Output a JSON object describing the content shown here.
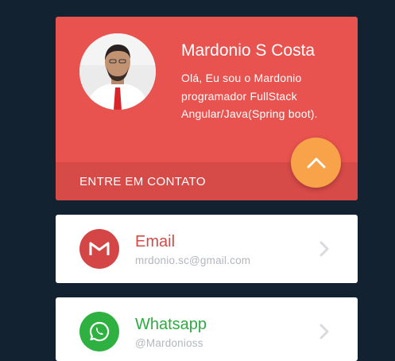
{
  "profile": {
    "name": "Mardonio S Costa",
    "bio": "Olá, Eu sou o Mardonio programador FullStack Angular/Java(Spring boot).",
    "contact_label": "ENTRE EM CONTATO",
    "avatar_icon": "profile-photo",
    "toggle_icon": "chevron-up-icon"
  },
  "contacts": [
    {
      "title": "Email",
      "value": "mrdonio.sc@gmail.com",
      "icon": "gmail-icon",
      "color": "#d34b47"
    },
    {
      "title": "Whatsapp",
      "value": "@Mardonioss",
      "icon": "whatsapp-icon",
      "color": "#2fa943"
    }
  ],
  "colors": {
    "background": "#122230",
    "card_accent": "#e8524f",
    "button_accent": "#f8a24a"
  }
}
